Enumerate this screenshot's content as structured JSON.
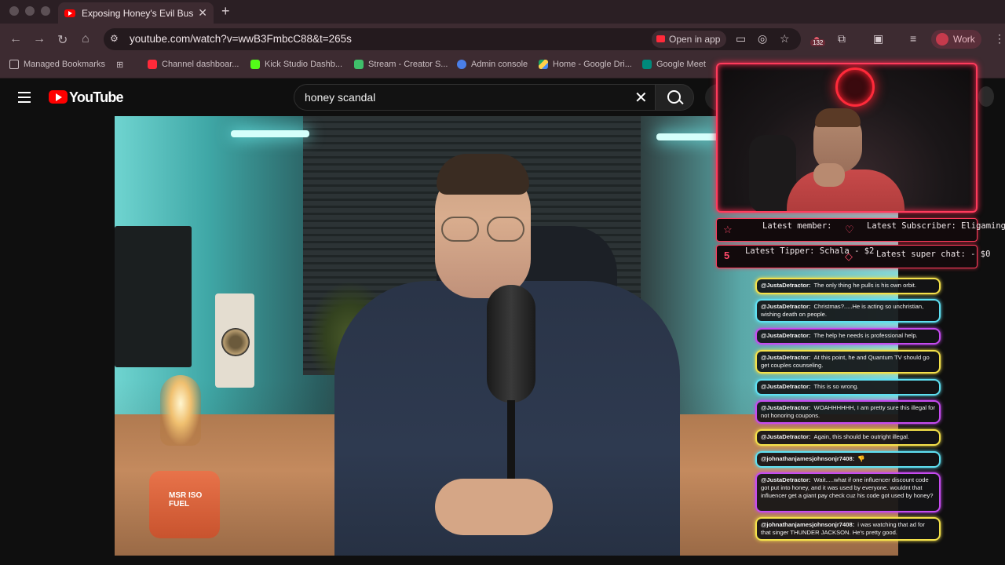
{
  "browser": {
    "tab_title": "Exposing Honey's Evil Busine",
    "url": "youtube.com/watch?v=wwB3FmbcC88&t=265s",
    "open_in_app": "Open in app",
    "extension_badge": "132",
    "profile_label": "Work",
    "bookmarks": [
      {
        "label": "Managed Bookmarks",
        "icon": "folder-icon"
      },
      {
        "label": "Channel dashboar...",
        "icon": "youtube-icon"
      },
      {
        "label": "Kick Studio Dashb...",
        "icon": "kick-icon"
      },
      {
        "label": "Stream - Creator S...",
        "icon": "puzzle-icon"
      },
      {
        "label": "Admin console",
        "icon": "google-admin-icon"
      },
      {
        "label": "Home - Google Dri...",
        "icon": "drive-icon"
      },
      {
        "label": "Google Meet",
        "icon": "meet-icon"
      }
    ]
  },
  "youtube": {
    "wordmark": "YouTube",
    "search_query": "honey scandal"
  },
  "video": {
    "lamp_label": "MSR ISO FUEL"
  },
  "overlay": {
    "latest_member": "Latest member:",
    "latest_subscriber": "Latest Subscriber: Eligaming",
    "latest_tipper": "Latest Tipper: Schala - $2",
    "latest_superchat": "Latest super chat:  - $0",
    "tipper_icon_glyph": "5"
  },
  "chat": [
    {
      "author": "@JustaDetractor:",
      "text": "The only thing he pulls is his own orbit.",
      "color": "#f4e14a"
    },
    {
      "author": "@JustaDetractor:",
      "text": "Christmas?.....He is acting so unchristian, wishing death on people.",
      "color": "#5fe0f2"
    },
    {
      "author": "@JustaDetractor:",
      "text": "The help he needs is professional help.",
      "color": "#c64bf0"
    },
    {
      "author": "@JustaDetractor:",
      "text": "At this point, he and Quantum TV should go get couples counseling.",
      "color": "#f4e14a"
    },
    {
      "author": "@JustaDetractor:",
      "text": "This is so wrong.",
      "color": "#5fe0f2"
    },
    {
      "author": "@JustaDetractor:",
      "text": "WOAHHHHHH, I am pretty sure this illegal for not honoring coupons.",
      "color": "#c64bf0"
    },
    {
      "author": "@JustaDetractor:",
      "text": "Again, this should be outright illegal.",
      "color": "#f4e14a"
    },
    {
      "author": "@johnathanjamesjohnsonjr7408:",
      "text": "👎",
      "color": "#5fe0f2"
    },
    {
      "author": "@JustaDetractor:",
      "text": "Wait.....what if one influencer discount code got put into honey, and it was used by everyone. wouldnt that influencer get a giant pay check cuz his code got used by honey?",
      "color": "#c64bf0"
    },
    {
      "author": "@johnathanjamesjohnsonjr7408:",
      "text": "i was watching that ad for that singer THUNDER JACKSON. He's pretty good.",
      "color": "#f4e14a"
    }
  ]
}
